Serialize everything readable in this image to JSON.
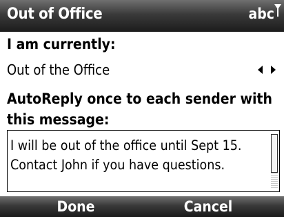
{
  "title_bar": {
    "title": "Out of Office",
    "input_mode": "abc",
    "signal_icon": "signal-antenna-icon"
  },
  "current_status": {
    "label": "I am currently:",
    "value": "Out of the Office",
    "arrows_icon": "left-right-arrows-icon"
  },
  "auto_reply": {
    "label": "AutoReply once to each sender with this message:",
    "message": "I will be out of the office until Sept 15. Contact John if you have questions."
  },
  "softkeys": {
    "left": "Done",
    "right": "Cancel"
  },
  "colors": {
    "bar_dark": "#1c1c1c",
    "bar_light": "#6f6f6f",
    "text": "#000000",
    "background": "#ffffff"
  }
}
